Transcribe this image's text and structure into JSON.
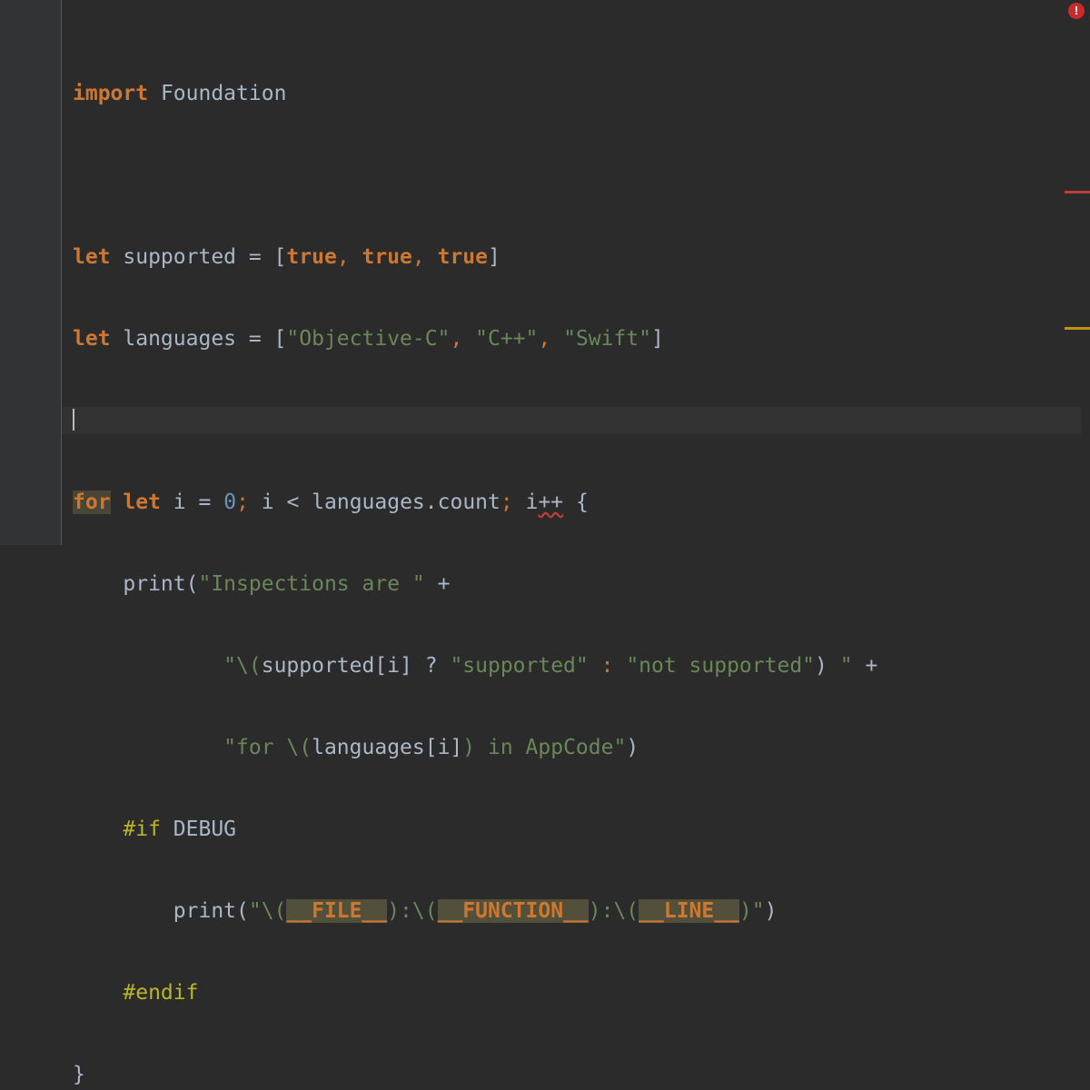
{
  "status": {
    "error_icon": "error-icon",
    "error_glyph": "!",
    "error_color": "#c72b2b",
    "marker_colors": [
      "#bc3f3c",
      "#be9117"
    ]
  },
  "colors": {
    "background": "#2b2b2b",
    "keyword": "#cc7832",
    "string": "#6a8759",
    "number": "#6897bb",
    "preprocessor": "#bbb529",
    "identifier": "#a9b7c6"
  },
  "code": {
    "l1": {
      "kw": "import",
      "rest": " Foundation"
    },
    "l3": {
      "kw": "let",
      "a": " supported = [",
      "t1": "true",
      "c1": ", ",
      "t2": "true",
      "c2": ", ",
      "t3": "true",
      "b": "]"
    },
    "l4": {
      "kw": "let",
      "a": " languages = [",
      "s1": "\"Objective-C\"",
      "c1": ", ",
      "s2": "\"C++\"",
      "c2": ", ",
      "s3": "\"Swift\"",
      "b": "]"
    },
    "l6": {
      "kw1": "for",
      "sp1": " ",
      "kw2": "let",
      "a": " i = ",
      "n": "0",
      "semi1": ";",
      "b": " i < languages.count",
      "semi2": ";",
      "sp2": " ",
      "i1": "i",
      "pp": "++",
      "c": " {"
    },
    "l7": {
      "indent": "    ",
      "fn": "print(",
      "s": "\"Inspections are \"",
      "plus": " +"
    },
    "l8": {
      "indent": "            ",
      "s1": "\"\\(",
      "a": "supported[i] ? ",
      "s2": "\"supported\"",
      "colon": " : ",
      "s3": "\"not supported\"",
      "b": ")",
      "s4": " \"",
      "plus": " +"
    },
    "l9": {
      "indent": "            ",
      "s1": "\"for \\(",
      "a": "languages[i]",
      "b": ")",
      "s2": " in AppCode\"",
      "c": ")"
    },
    "l10": {
      "indent": "    ",
      "pp": "#if",
      "rest": " DEBUG"
    },
    "l11": {
      "indent": "        ",
      "fn": "print(",
      "s1": "\"\\(",
      "m1": "__FILE__",
      "s2": "):\\(",
      "m2": "__FUNCTION__",
      "s3": "):\\(",
      "m3": "__LINE__",
      "s4": ")\"",
      "c": ")"
    },
    "l12": {
      "indent": "    ",
      "pp": "#endif"
    },
    "l13": {
      "brace": "}"
    }
  }
}
